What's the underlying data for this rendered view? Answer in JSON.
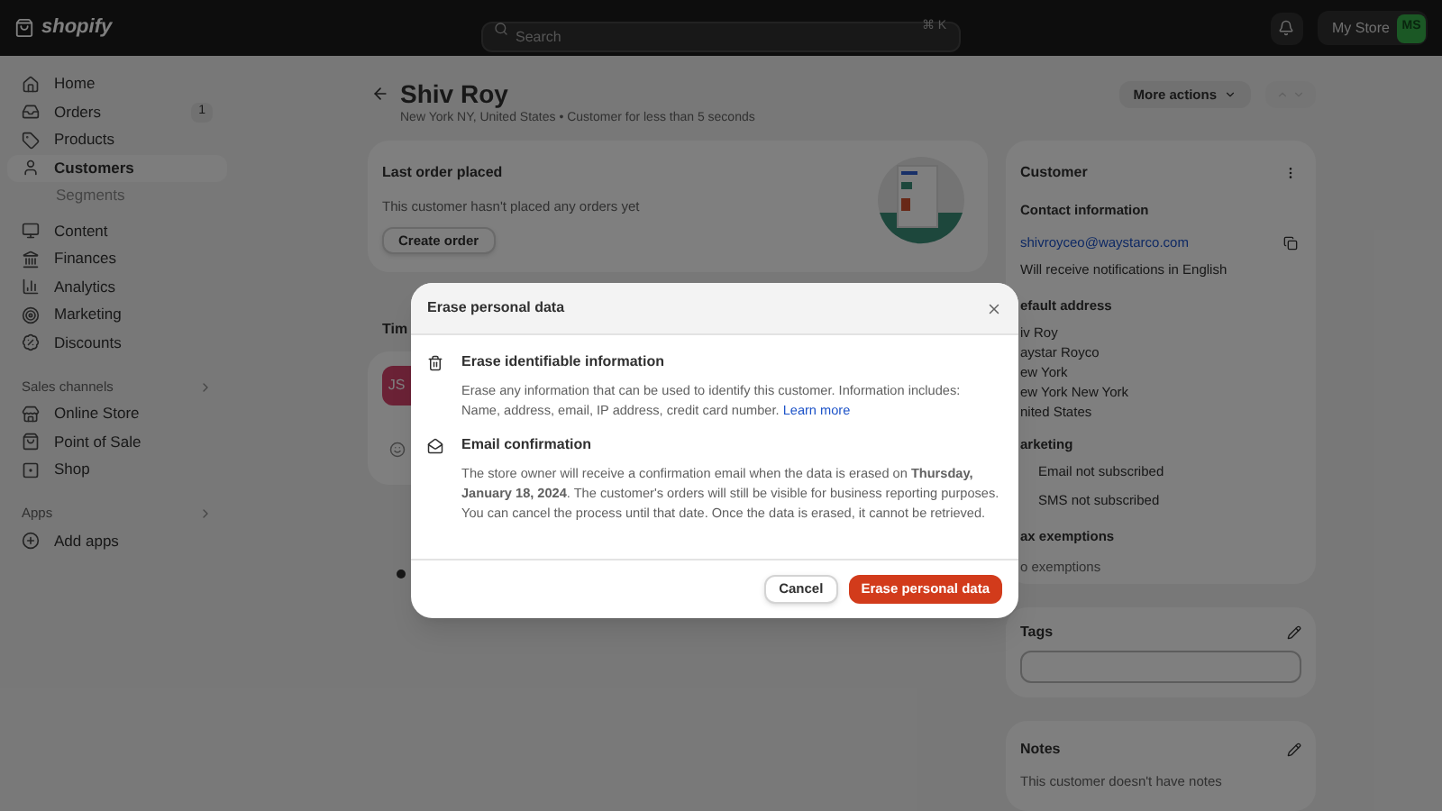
{
  "topbar": {
    "logo": "shopify",
    "search": {
      "placeholder": "Search",
      "shortcut": "⌘ K"
    },
    "store": "My Store",
    "avatar": "MS"
  },
  "sidebar": {
    "items": [
      {
        "label": "Home",
        "selected": false
      },
      {
        "label": "Orders",
        "badge": "1",
        "selected": false
      },
      {
        "label": "Products",
        "selected": false
      },
      {
        "label": "Customers",
        "selected": true,
        "children": [
          {
            "label": "Segments",
            "selected": false
          }
        ]
      },
      {
        "label": "Content",
        "selected": false
      },
      {
        "label": "Finances",
        "selected": false
      },
      {
        "label": "Analytics",
        "selected": false
      },
      {
        "label": "Marketing",
        "selected": false
      },
      {
        "label": "Discounts",
        "selected": false
      }
    ],
    "sections": [
      {
        "title": "Sales channels",
        "items": [
          {
            "label": "Online Store",
            "selected": false
          },
          {
            "label": "Point of Sale",
            "selected": false
          },
          {
            "label": "Shop",
            "selected": false
          }
        ]
      },
      {
        "title": "Apps",
        "items": [
          {
            "label": "Add apps",
            "selected": false
          }
        ]
      }
    ]
  },
  "page": {
    "title": "Shiv Roy",
    "subtitle": "New York NY, United States • Customer for less than 5 seconds",
    "more_actions": "More actions"
  },
  "last_order": {
    "title": "Last order placed",
    "text": "This customer hasn't placed any orders yet",
    "button": "Create order"
  },
  "timeline": {
    "title": "Tim",
    "avatar": "JS"
  },
  "customer_card": {
    "title": "Customer",
    "contact_title": "Contact information",
    "email": "shivroyceo@waystarco.com",
    "notifications": "Will receive notifications in English",
    "address_title": "efault address",
    "address_lines": [
      "iv Roy",
      "aystar Royco",
      "ew York",
      "ew York New York",
      "nited States"
    ],
    "marketing_title": "arketing",
    "marketing": [
      "Email not subscribed",
      "SMS not subscribed"
    ],
    "tax_title": "ax exemptions",
    "tax_text": "o exemptions"
  },
  "tags": {
    "title": "Tags"
  },
  "notes": {
    "title": "Notes",
    "text": "This customer doesn't have notes"
  },
  "modal": {
    "title": "Erase personal data",
    "sections": [
      {
        "kind": "trash",
        "title": "Erase identifiable information",
        "text": "Erase any information that can be used to identify this customer. Information includes: Name, address, email, IP address, credit card number.",
        "link": "Learn more"
      },
      {
        "kind": "mail",
        "title": "Email confirmation",
        "text": "The store owner will receive a confirmation email when the data is erased on **Thursday, January 18, 2024**. The customer's orders will still be visible for business reporting purposes. You can cancel the process until that date. Once the data is erased, it cannot be retrieved."
      }
    ],
    "cancel": "Cancel",
    "confirm": "Erase personal data"
  }
}
